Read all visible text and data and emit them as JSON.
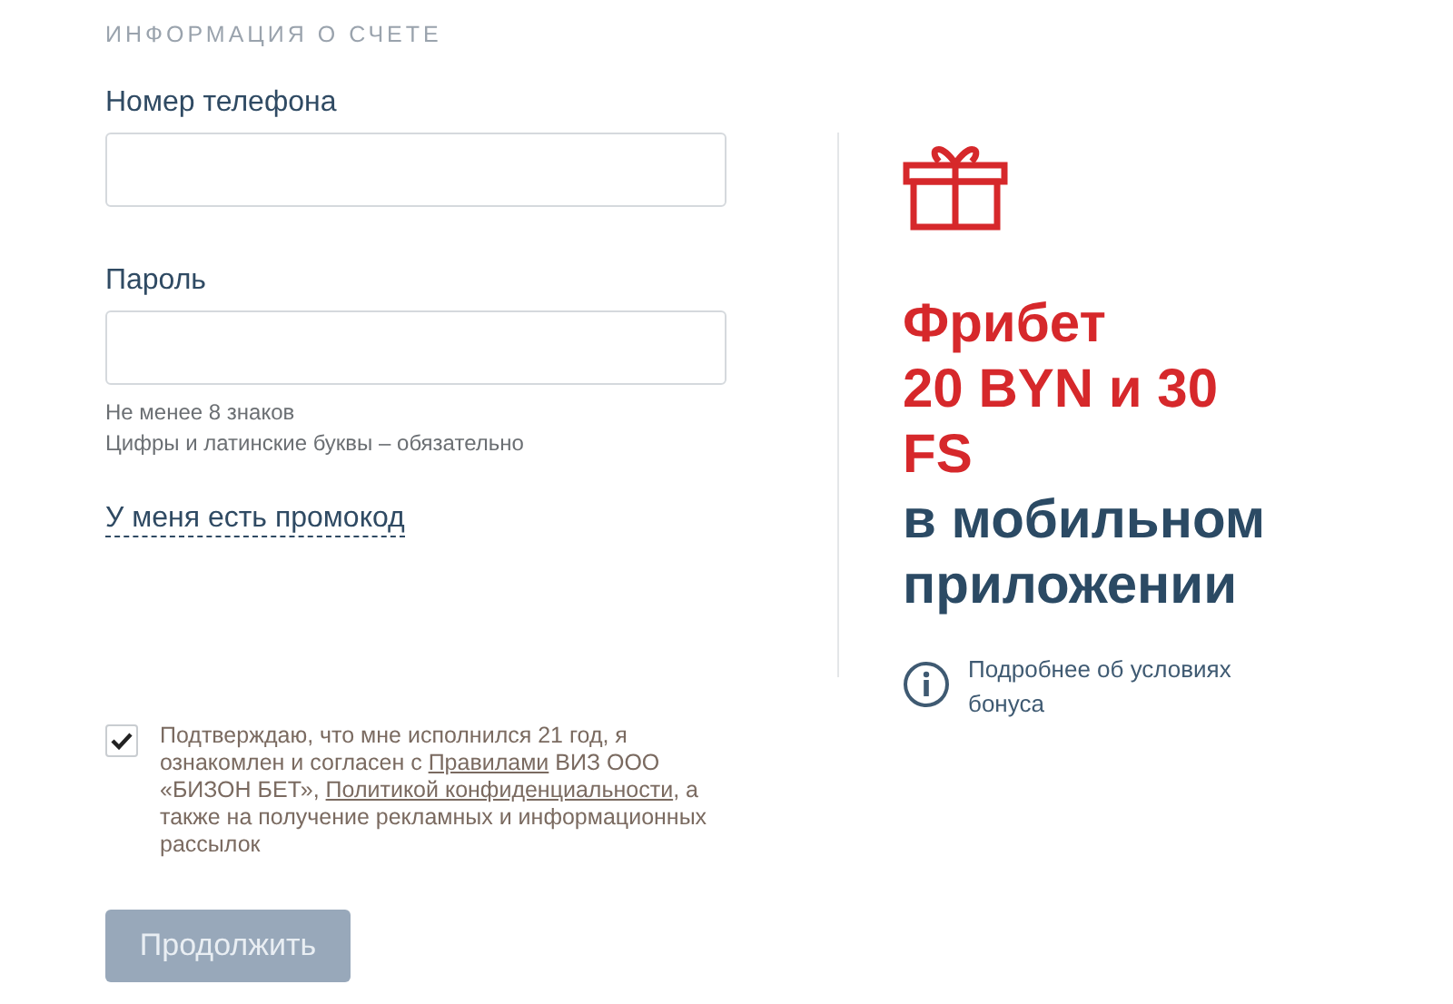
{
  "section_title": "ИНФОРМАЦИЯ О СЧЕТЕ",
  "fields": [
    {
      "label": "Номер телефона"
    },
    {
      "label": "Пароль",
      "hints": [
        "Не менее 8 знаков",
        "Цифры и латинские буквы – обязательно"
      ]
    }
  ],
  "promo_link": "У меня есть промокод",
  "consent": {
    "checked": true,
    "segments": [
      {
        "kind": "text",
        "text": "Подтверждаю, что мне исполнился 21 год, я ознакомлен и согласен с "
      },
      {
        "kind": "link",
        "text": "Правилами"
      },
      {
        "kind": "text",
        "text": " ВИЗ ООО «БИЗОН БЕТ», "
      },
      {
        "kind": "link",
        "text": "Политикой конфиденциальности"
      },
      {
        "kind": "text",
        "text": ", а также на получение рекламных и информационных рассылок"
      }
    ]
  },
  "submit": {
    "label": "Продолжить",
    "disabled": true
  },
  "bonus": {
    "title_lines": [
      {
        "text": "Фрибет",
        "highlight": true
      },
      {
        "text": "20 BYN и 30 FS",
        "highlight": true
      },
      {
        "text": "в мобильном приложении",
        "highlight": false
      }
    ],
    "info": "Подробнее об условиях бонуса"
  }
}
